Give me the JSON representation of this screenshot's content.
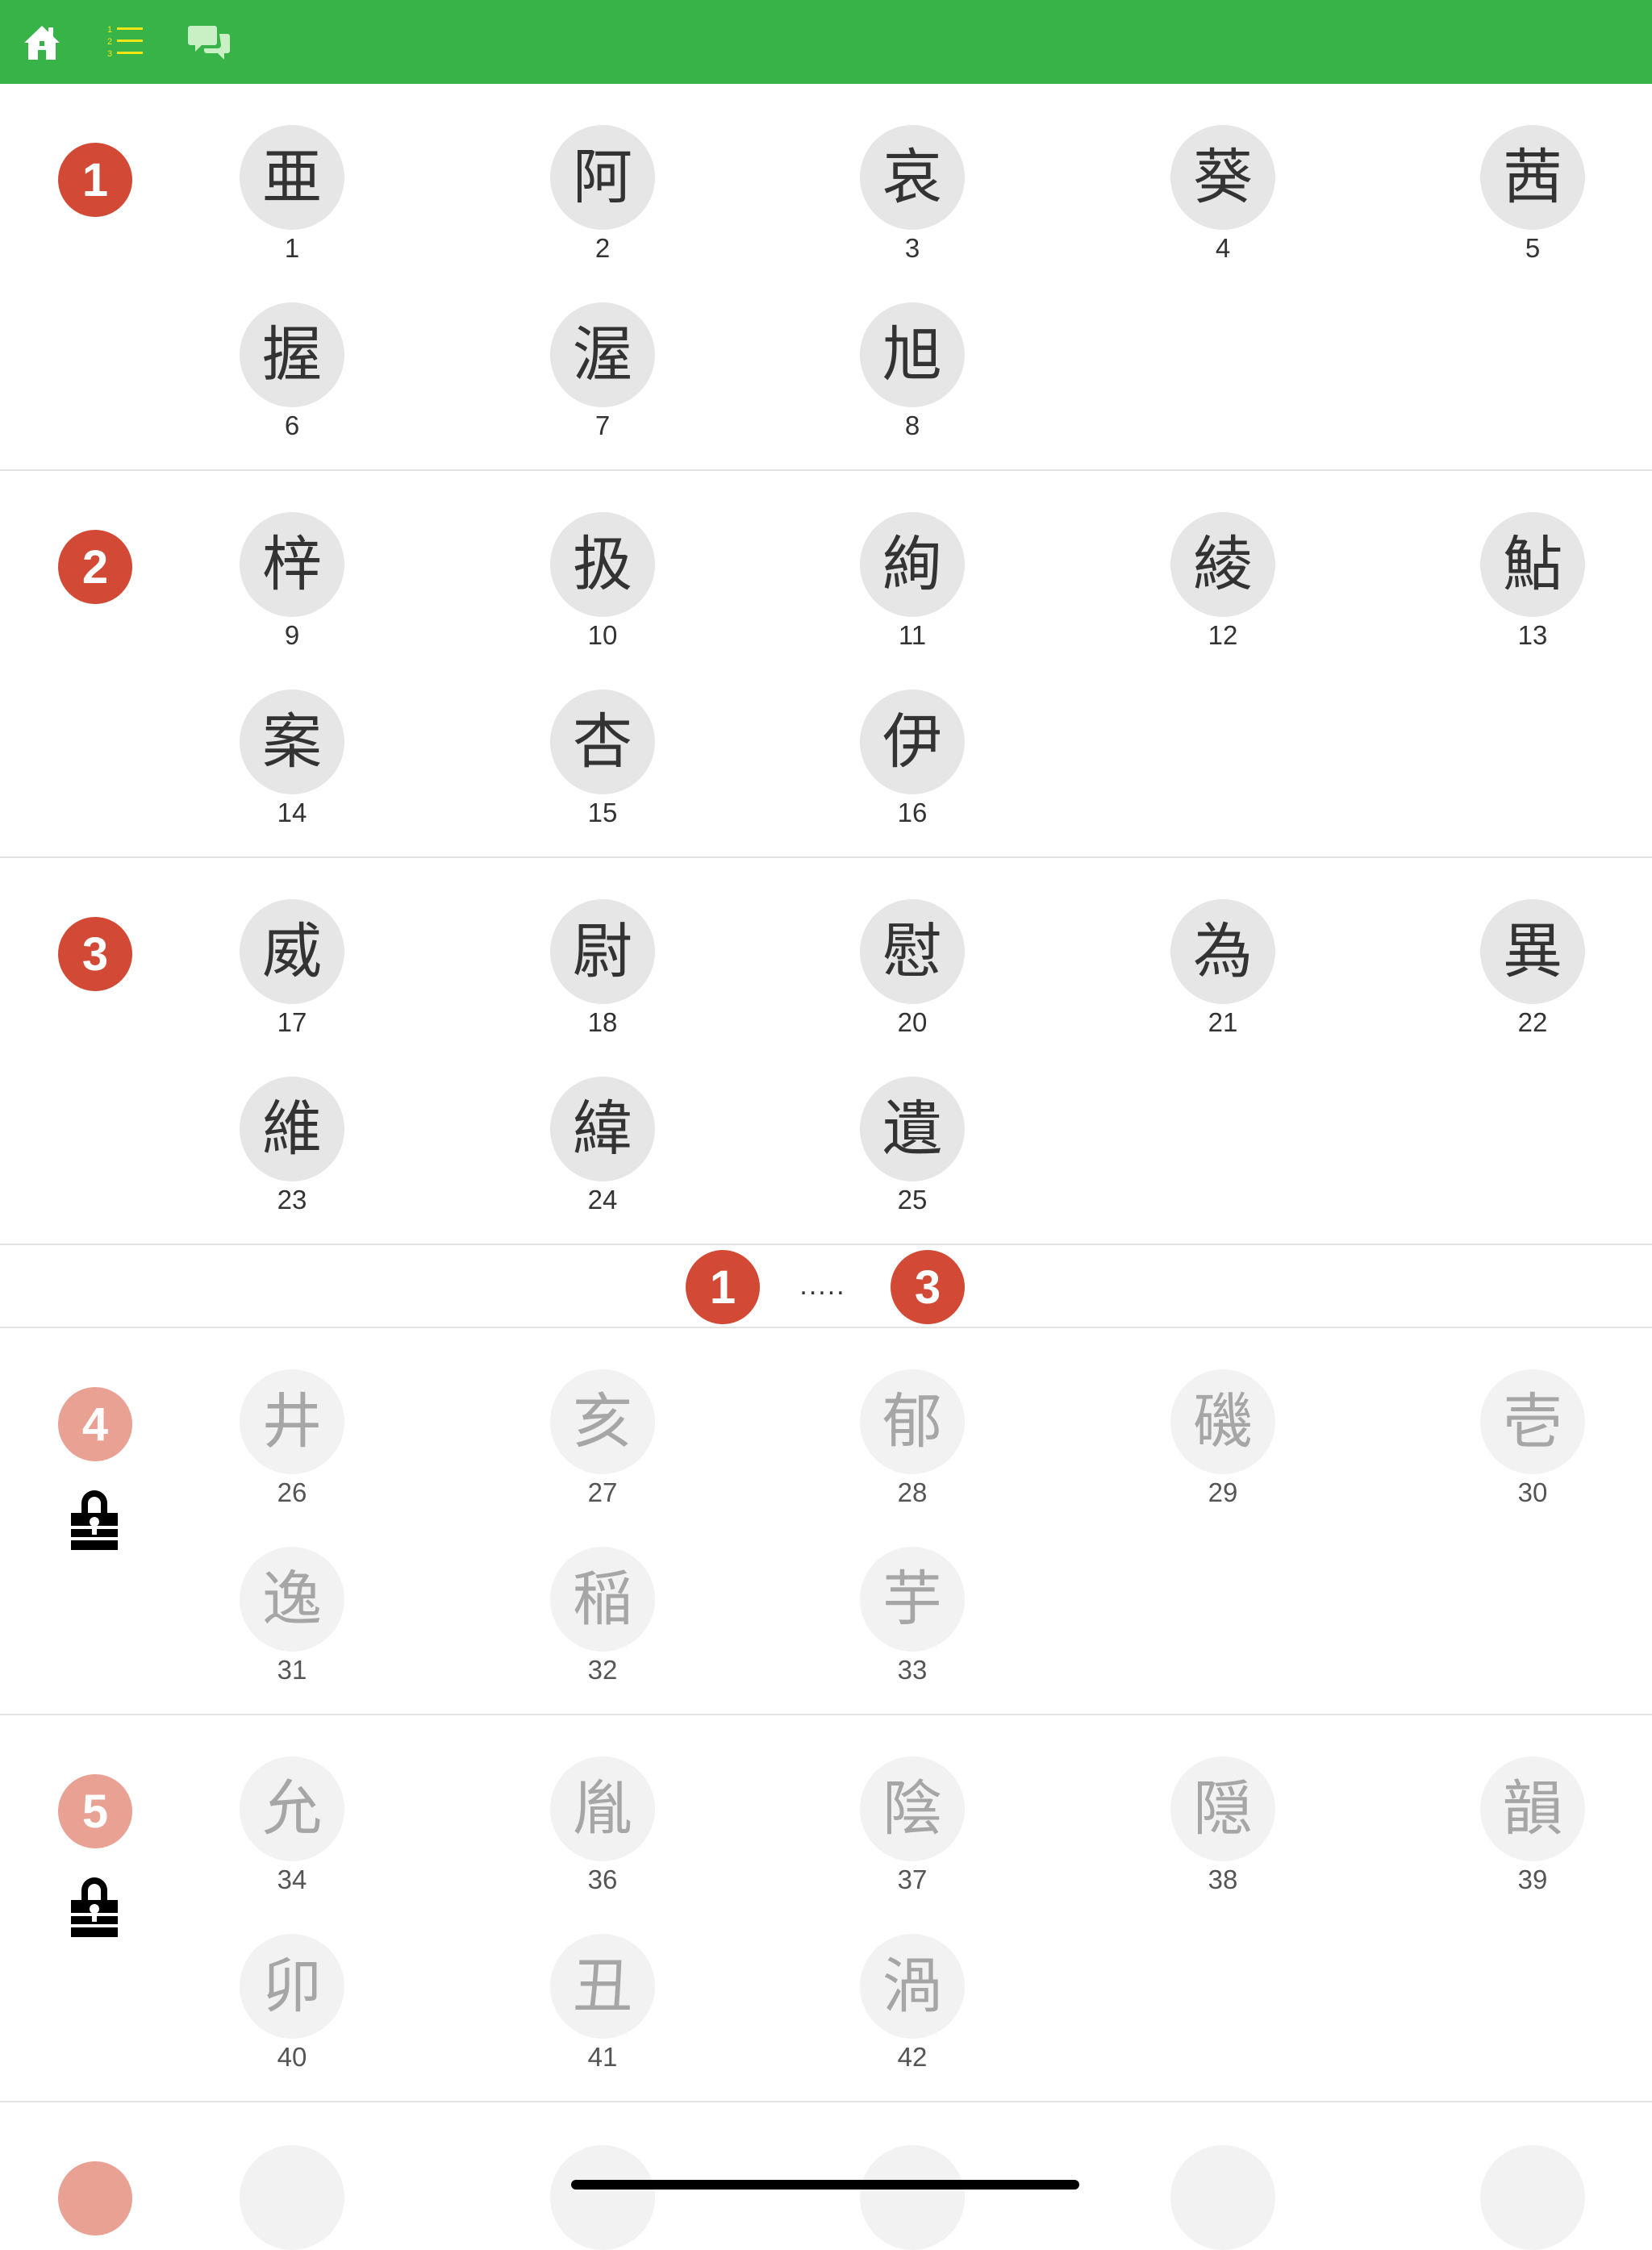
{
  "nav": {
    "home_icon": "home-icon",
    "list_icon": "numbered-list-icon",
    "chat_icon": "chat-bubbles-icon"
  },
  "colors": {
    "header": "#38b347",
    "badge": "#d24a35",
    "badge_locked": "#e9a193",
    "kanji_bg": "#e6e6e6",
    "kanji_bg_locked": "#f2f2f2"
  },
  "lessons": [
    {
      "number": "1",
      "locked": false,
      "kanji": [
        {
          "char": "亜",
          "num": "1"
        },
        {
          "char": "阿",
          "num": "2"
        },
        {
          "char": "哀",
          "num": "3"
        },
        {
          "char": "葵",
          "num": "4"
        },
        {
          "char": "茜",
          "num": "5"
        },
        {
          "char": "握",
          "num": "6"
        },
        {
          "char": "渥",
          "num": "7"
        },
        {
          "char": "旭",
          "num": "8"
        }
      ]
    },
    {
      "number": "2",
      "locked": false,
      "kanji": [
        {
          "char": "梓",
          "num": "9"
        },
        {
          "char": "扱",
          "num": "10"
        },
        {
          "char": "絢",
          "num": "11"
        },
        {
          "char": "綾",
          "num": "12"
        },
        {
          "char": "鮎",
          "num": "13"
        },
        {
          "char": "案",
          "num": "14"
        },
        {
          "char": "杏",
          "num": "15"
        },
        {
          "char": "伊",
          "num": "16"
        }
      ]
    },
    {
      "number": "3",
      "locked": false,
      "kanji": [
        {
          "char": "威",
          "num": "17"
        },
        {
          "char": "尉",
          "num": "18"
        },
        {
          "char": "慰",
          "num": "20"
        },
        {
          "char": "為",
          "num": "21"
        },
        {
          "char": "異",
          "num": "22"
        },
        {
          "char": "維",
          "num": "23"
        },
        {
          "char": "緯",
          "num": "24"
        },
        {
          "char": "遺",
          "num": "25"
        }
      ]
    },
    {
      "number": "4",
      "locked": true,
      "kanji": [
        {
          "char": "井",
          "num": "26"
        },
        {
          "char": "亥",
          "num": "27"
        },
        {
          "char": "郁",
          "num": "28"
        },
        {
          "char": "磯",
          "num": "29"
        },
        {
          "char": "壱",
          "num": "30"
        },
        {
          "char": "逸",
          "num": "31"
        },
        {
          "char": "稲",
          "num": "32"
        },
        {
          "char": "芋",
          "num": "33"
        }
      ]
    },
    {
      "number": "5",
      "locked": true,
      "kanji": [
        {
          "char": "允",
          "num": "34"
        },
        {
          "char": "胤",
          "num": "36"
        },
        {
          "char": "陰",
          "num": "37"
        },
        {
          "char": "隠",
          "num": "38"
        },
        {
          "char": "韻",
          "num": "39"
        },
        {
          "char": "卯",
          "num": "40"
        },
        {
          "char": "丑",
          "num": "41"
        },
        {
          "char": "渦",
          "num": "42"
        }
      ]
    }
  ],
  "range": {
    "start": "1",
    "dots": ".....",
    "end": "3"
  },
  "lock_icon": "padlock-icon"
}
